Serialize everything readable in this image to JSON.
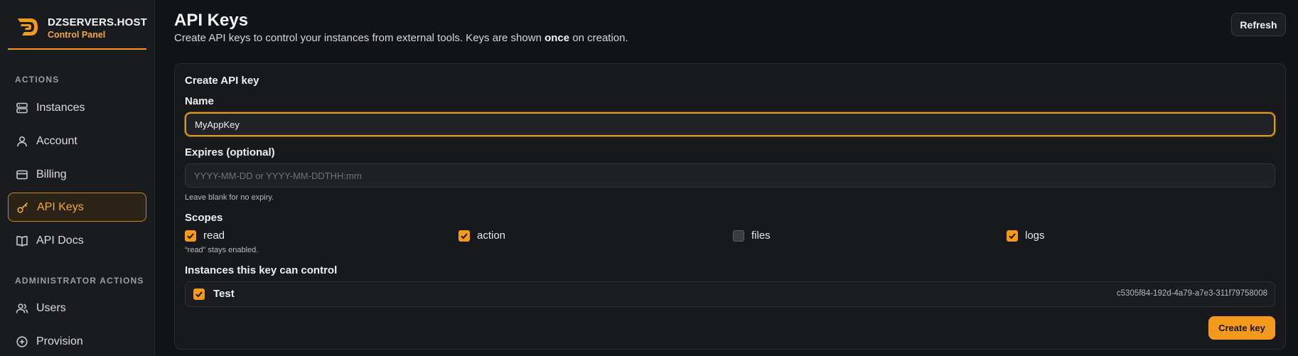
{
  "brand": {
    "name": "DZSERVERS.HOST",
    "subtitle": "Control Panel"
  },
  "sidebar": {
    "sections": [
      {
        "label": "ACTIONS"
      },
      {
        "label": "ADMINISTRATOR ACTIONS"
      }
    ],
    "items": [
      {
        "label": "Instances",
        "icon": "server-icon"
      },
      {
        "label": "Account",
        "icon": "user-icon"
      },
      {
        "label": "Billing",
        "icon": "credit-card-icon"
      },
      {
        "label": "API Keys",
        "icon": "key-icon",
        "active": true
      },
      {
        "label": "API Docs",
        "icon": "book-icon"
      },
      {
        "label": "Users",
        "icon": "users-icon"
      },
      {
        "label": "Provision",
        "icon": "plus-circle-icon"
      }
    ]
  },
  "header": {
    "title": "API Keys",
    "subtitle_pre": "Create API keys to control your instances from external tools. Keys are shown ",
    "subtitle_bold": "once",
    "subtitle_post": " on creation.",
    "refresh_label": "Refresh"
  },
  "form": {
    "card_title": "Create API key",
    "name_label": "Name",
    "name_value": "MyAppKey",
    "expires_label": "Expires (optional)",
    "expires_placeholder": "YYYY-MM-DD or YYYY-MM-DDTHH:mm",
    "expires_hint": "Leave blank for no expiry.",
    "scopes_label": "Scopes",
    "scopes": [
      {
        "label": "read",
        "checked": true
      },
      {
        "label": "action",
        "checked": true
      },
      {
        "label": "files",
        "checked": false
      },
      {
        "label": "logs",
        "checked": true
      }
    ],
    "scopes_hint": "“read” stays enabled.",
    "instances_label": "Instances this key can control",
    "instances": [
      {
        "name": "Test",
        "id": "c5305f84-192d-4a79-a7e3-311f79758008",
        "checked": true
      }
    ],
    "create_label": "Create key"
  },
  "colors": {
    "accent": "#f39a1c",
    "background": "#121316",
    "sidebar": "#1a1b1f"
  }
}
